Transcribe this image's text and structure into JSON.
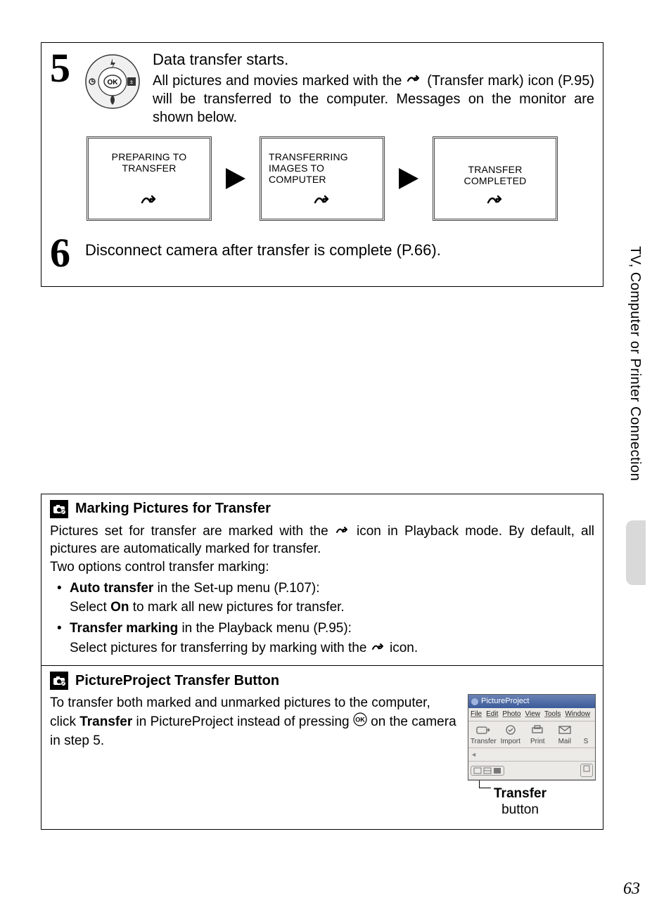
{
  "side_tab": "TV, Computer or Printer Connection",
  "page_number": "63",
  "step5": {
    "number": "5",
    "title": "Data transfer starts.",
    "body_before_icon": "All pictures and movies marked with the ",
    "body_after_icon": " (Transfer mark) icon (P.95) will be transferred to the computer. Messages on the monitor are shown below."
  },
  "transfer_panels": {
    "p1": "PREPARING TO TRANSFER",
    "p2": "TRANSFERRING IMAGES TO COMPUTER",
    "p3": "TRANSFER COMPLETED"
  },
  "step6": {
    "number": "6",
    "body": "Disconnect camera after transfer is complete (P.66)."
  },
  "marking": {
    "heading": "Marking Pictures for Transfer",
    "p1_before": "Pictures set for transfer are marked with the ",
    "p1_after": " icon in Playback mode. By default, all pictures are automatically marked for transfer.",
    "p2": "Two options control transfer marking:",
    "b1_bold": "Auto transfer",
    "b1_rest": " in the Set-up menu (P.107):",
    "b1_sub_before": "Select ",
    "b1_sub_bold": "On",
    "b1_sub_after": " to mark all new pictures for transfer.",
    "b2_bold": "Transfer marking",
    "b2_rest": " in the Playback menu (P.95):",
    "b2_sub_before": "Select pictures for transferring by marking with the ",
    "b2_sub_after": " icon."
  },
  "ppbutton": {
    "heading": "PictureProject Transfer Button",
    "p_before": "To transfer both marked and unmarked pictures to the computer, click ",
    "p_bold": "Transfer",
    "p_mid": " in PictureProject instead of pressing ",
    "p_after": " on the camera in step 5."
  },
  "pp_window": {
    "title": "PictureProject",
    "menus": {
      "file": "File",
      "edit": "Edit",
      "photo": "Photo",
      "view": "View",
      "tools": "Tools",
      "window": "Window"
    },
    "tools": {
      "transfer": "Transfer",
      "import": "Import",
      "print": "Print",
      "mail": "Mail",
      "s": "S"
    },
    "callout_bold": "Transfer",
    "callout_rest": "button"
  }
}
